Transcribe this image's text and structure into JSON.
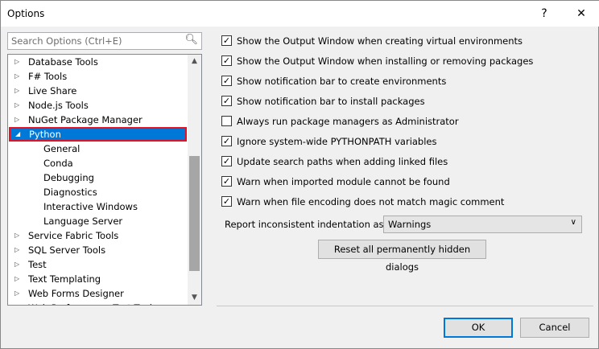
{
  "window": {
    "title": "Options",
    "help": "?",
    "close": "✕"
  },
  "search": {
    "placeholder": "Search Options (Ctrl+E)"
  },
  "tree": [
    {
      "label": "Database Tools",
      "level": 0,
      "expanded": false
    },
    {
      "label": "F# Tools",
      "level": 0,
      "expanded": false
    },
    {
      "label": "Live Share",
      "level": 0,
      "expanded": false
    },
    {
      "label": "Node.js Tools",
      "level": 0,
      "expanded": false
    },
    {
      "label": "NuGet Package Manager",
      "level": 0,
      "expanded": false
    },
    {
      "label": "Python",
      "level": 0,
      "expanded": true,
      "selected": true
    },
    {
      "label": "General",
      "level": 1
    },
    {
      "label": "Conda",
      "level": 1
    },
    {
      "label": "Debugging",
      "level": 1
    },
    {
      "label": "Diagnostics",
      "level": 1
    },
    {
      "label": "Interactive Windows",
      "level": 1
    },
    {
      "label": "Language Server",
      "level": 1
    },
    {
      "label": "Service Fabric Tools",
      "level": 0,
      "expanded": false
    },
    {
      "label": "SQL Server Tools",
      "level": 0,
      "expanded": false
    },
    {
      "label": "Test",
      "level": 0,
      "expanded": false
    },
    {
      "label": "Text Templating",
      "level": 0,
      "expanded": false
    },
    {
      "label": "Web Forms Designer",
      "level": 0,
      "expanded": false
    },
    {
      "label": "Web Performance Test Tools",
      "level": 0,
      "expanded": false
    }
  ],
  "options": [
    {
      "label": "Show the Output Window when creating virtual environments",
      "checked": true
    },
    {
      "label": "Show the Output Window when installing or removing packages",
      "checked": true
    },
    {
      "label": "Show notification bar to create environments",
      "checked": true
    },
    {
      "label": "Show notification bar to install packages",
      "checked": true
    },
    {
      "label": "Always run package managers as Administrator",
      "checked": false
    },
    {
      "label": "Ignore system-wide PYTHONPATH variables",
      "checked": true
    },
    {
      "label": "Update search paths when adding linked files",
      "checked": true
    },
    {
      "label": "Warn when imported module cannot be found",
      "checked": true
    },
    {
      "label": "Warn when file encoding does not match magic comment",
      "checked": true
    }
  ],
  "indentation": {
    "label": "Report inconsistent indentation as",
    "value": "Warnings"
  },
  "buttons": {
    "reset": "Reset all permanently hidden dialogs",
    "ok": "OK",
    "cancel": "Cancel"
  }
}
